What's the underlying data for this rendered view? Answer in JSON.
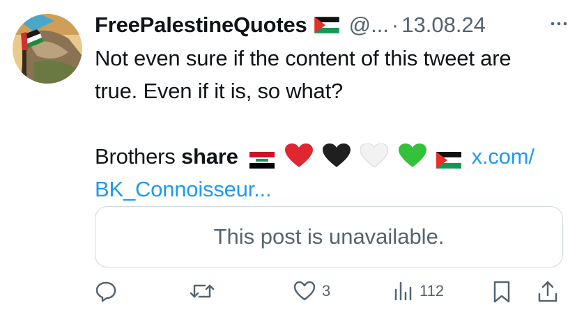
{
  "tweet": {
    "author_name": "FreePalestineQuotes",
    "handle": "@...",
    "separator": "·",
    "date": "13.08.24",
    "text_line1": "Not even sure if the content of this tweet are",
    "text_line2": "true. Even if it is, so what?",
    "text_prefix": "Brothers",
    "text_bold": "share",
    "link_part1": "x.com/",
    "link_part2": "BK_Connoisseur...",
    "quoted_post_message": "This post is unavailable."
  },
  "actions": {
    "likes_count": "3",
    "views_count": "112"
  },
  "icons": {
    "more": "more-horizontal-icon",
    "reply": "reply-icon",
    "retweet": "retweet-icon",
    "like": "heart-icon",
    "views": "views-icon",
    "bookmark": "bookmark-icon",
    "share": "share-icon"
  },
  "colors": {
    "text": "#0f1419",
    "secondary": "#536471",
    "link": "#1d9bf0",
    "border": "#cfd9de"
  }
}
